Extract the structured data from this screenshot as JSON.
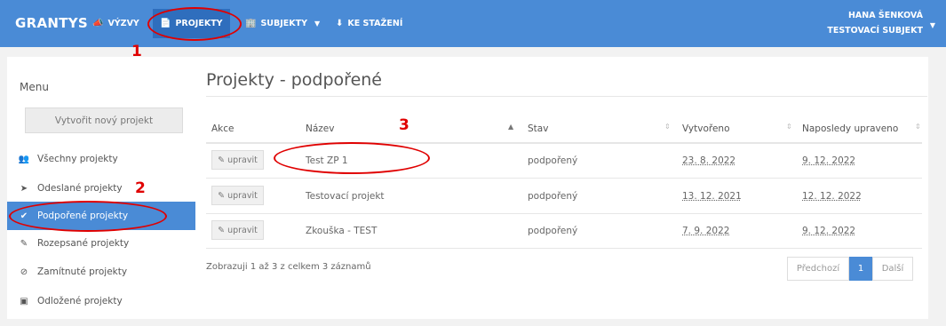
{
  "navbar": {
    "brand": "GRANTYS",
    "items": [
      {
        "label": "VÝZVY",
        "icon": "megaphone-icon"
      },
      {
        "label": "PROJEKTY",
        "icon": "document-icon",
        "active": true
      },
      {
        "label": "SUBJEKTY",
        "icon": "building-icon"
      },
      {
        "label": "KE STAŽENÍ",
        "icon": "download-icon"
      }
    ],
    "user_name": "HANA ŠENKOVÁ",
    "user_org": "TESTOVACÍ SUBJEKT"
  },
  "sidebar": {
    "title": "Menu",
    "new_project": "Vytvořit nový projekt",
    "items": [
      {
        "label": "Všechny projekty",
        "icon": "users-icon"
      },
      {
        "label": "Odeslané projekty",
        "icon": "send-icon"
      },
      {
        "label": "Podpořené projekty",
        "icon": "check-icon",
        "active": true
      },
      {
        "label": "Rozepsané projekty",
        "icon": "pencil-icon"
      },
      {
        "label": "Zamítnuté projekty",
        "icon": "ban-icon"
      },
      {
        "label": "Odložené projekty",
        "icon": "archive-icon"
      }
    ]
  },
  "main": {
    "title": "Projekty - podpořené",
    "columns": [
      "Akce",
      "Název",
      "Stav",
      "Vytvořeno",
      "Naposledy upraveno"
    ],
    "rows": [
      {
        "action": "upravit",
        "name": "Test ZP 1",
        "status": "podpořený",
        "created": "23. 8. 2022",
        "modified": "9. 12. 2022"
      },
      {
        "action": "upravit",
        "name": "Testovací projekt",
        "status": "podpořený",
        "created": "13. 12. 2021",
        "modified": "12. 12. 2022"
      },
      {
        "action": "upravit",
        "name": "Zkouška - TEST",
        "status": "podpořený",
        "created": "7. 9. 2022",
        "modified": "9. 12. 2022"
      }
    ],
    "footer_info": "Zobrazuji 1 až 3 z celkem 3 záznamů",
    "pager": {
      "prev": "Předchozí",
      "current": "1",
      "next": "Další"
    }
  },
  "annotations": {
    "one": "1",
    "two": "2",
    "three": "3"
  },
  "colors": {
    "accent": "#4a8bd6",
    "annotation": "#e00000"
  }
}
